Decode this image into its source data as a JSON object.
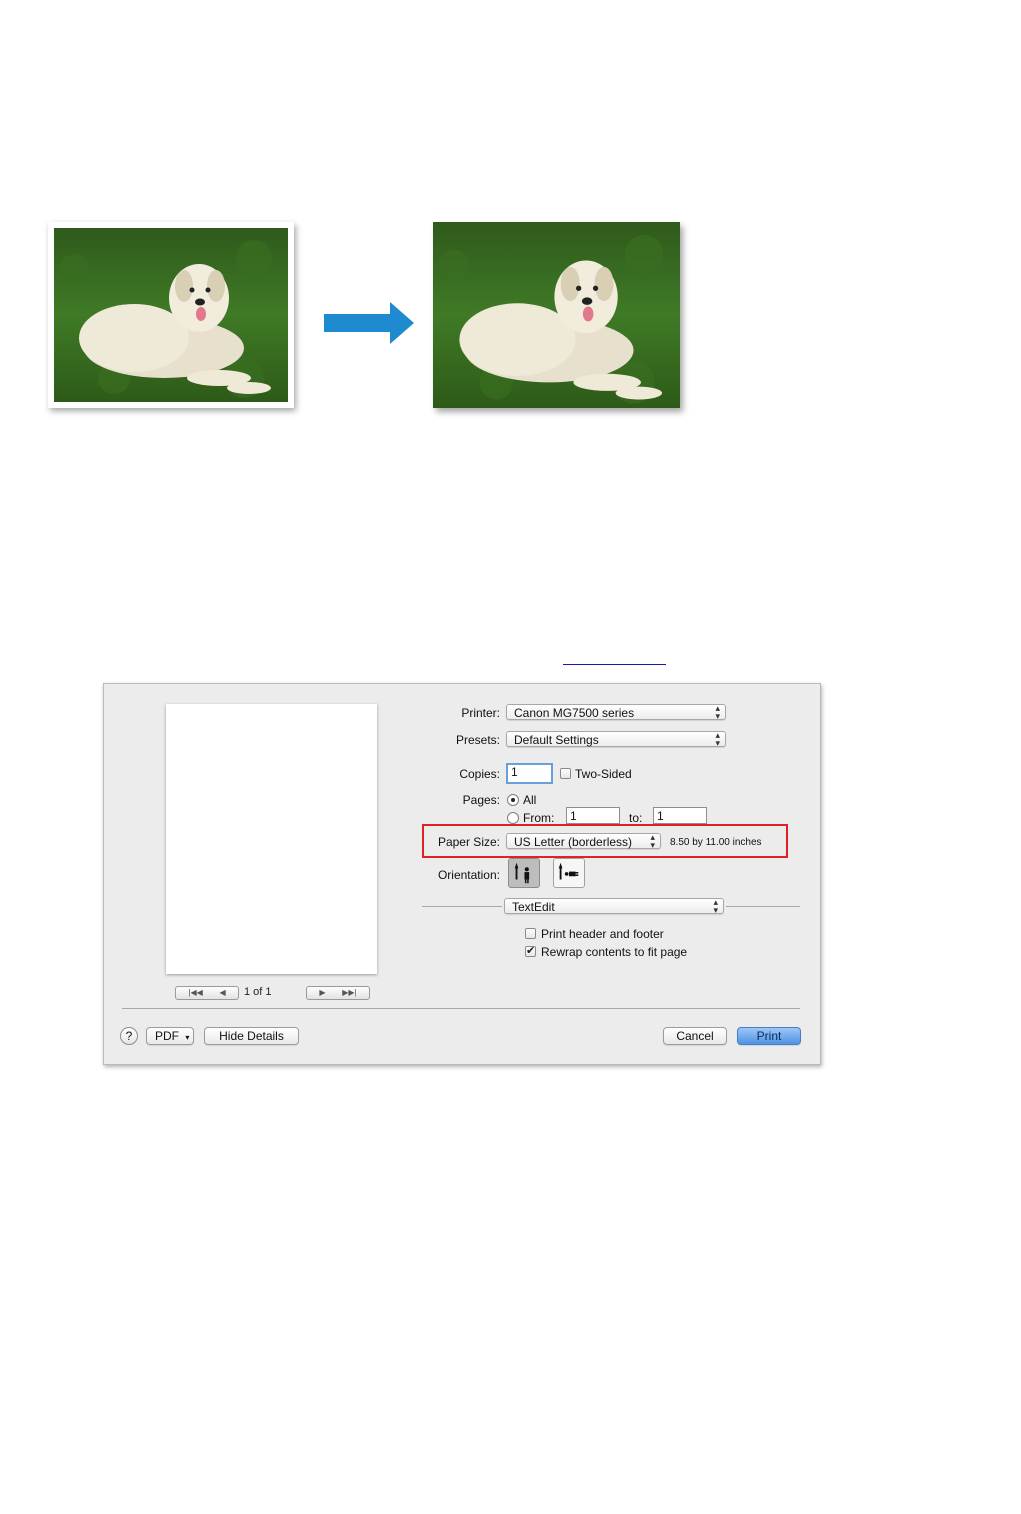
{
  "dialog": {
    "printer": {
      "label": "Printer:",
      "value": "Canon MG7500 series"
    },
    "presets": {
      "label": "Presets:",
      "value": "Default Settings"
    },
    "copies": {
      "label": "Copies:",
      "value": "1",
      "two_sided_label": "Two-Sided",
      "two_sided_checked": false
    },
    "pages": {
      "label": "Pages:",
      "all_label": "All",
      "from_label": "From:",
      "from_value": "1",
      "to_label": "to:",
      "to_value": "1",
      "selected": "All"
    },
    "paper_size": {
      "label": "Paper Size:",
      "value": "US Letter (borderless)",
      "dimensions": "8.50 by 11.00 inches"
    },
    "orientation": {
      "label": "Orientation:",
      "selected": "portrait"
    },
    "app_section": {
      "value": "TextEdit"
    },
    "options": [
      {
        "label": "Print header and footer",
        "checked": false
      },
      {
        "label": "Rewrap contents to fit page",
        "checked": true
      }
    ],
    "preview": {
      "page_indicator": "1 of 1"
    },
    "buttons": {
      "help": "?",
      "pdf": "PDF",
      "hide_details": "Hide Details",
      "cancel": "Cancel",
      "print": "Print"
    }
  },
  "colors": {
    "highlight": "#e2202a",
    "arrow": "#1e8ad0",
    "print_button": "#4f93e6"
  },
  "icons": [
    "arrow-right-icon",
    "help-icon",
    "portrait-orientation-icon",
    "landscape-orientation-icon",
    "popup-chevron-icon",
    "checkmark-icon"
  ]
}
